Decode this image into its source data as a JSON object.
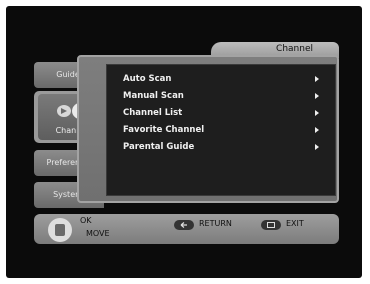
{
  "main": {
    "tab_title": "Channel",
    "items": [
      {
        "label": "Auto Scan"
      },
      {
        "label": "Manual Scan"
      },
      {
        "label": "Channel List"
      },
      {
        "label": "Favorite Channel"
      },
      {
        "label": "Parental Guide"
      }
    ]
  },
  "sidebar": {
    "tabs": [
      {
        "label": "Guide"
      },
      {
        "label": "Channel"
      },
      {
        "label": "Preference"
      },
      {
        "label": "System"
      }
    ],
    "active_index": 1
  },
  "footer": {
    "ok_label": "OK",
    "move_label": "MOVE",
    "return_label": "RETURN",
    "exit_label": "EXIT"
  }
}
